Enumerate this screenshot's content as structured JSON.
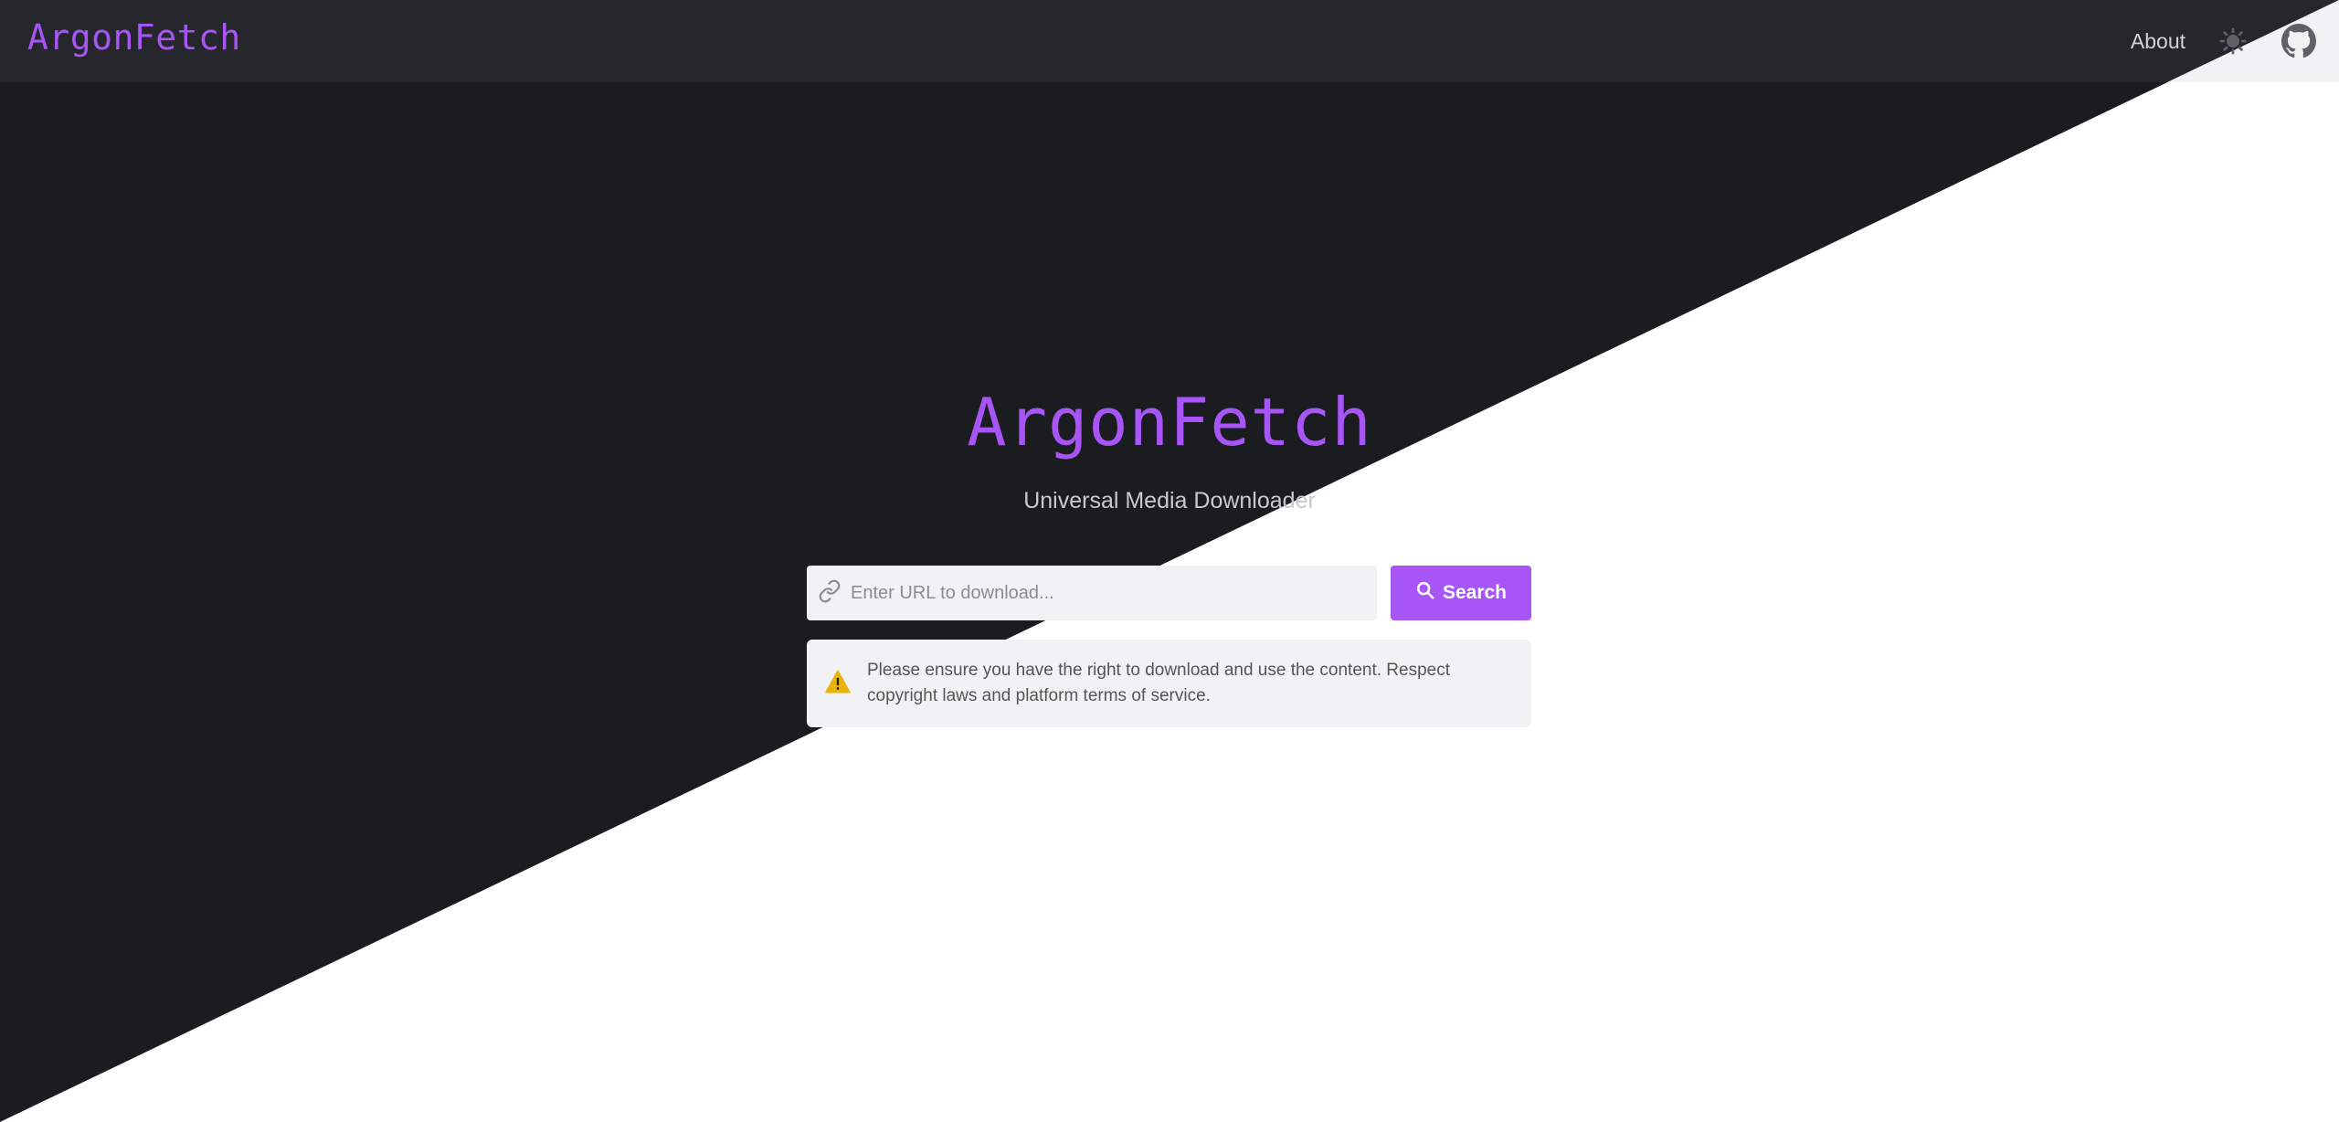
{
  "navbar": {
    "brand": "ArgonFetch",
    "about_label": "About",
    "theme_icon": "sun-icon",
    "github_icon": "github-icon"
  },
  "hero": {
    "title": "ArgonFetch",
    "subtitle": "Universal Media Downloader"
  },
  "search": {
    "link_icon": "link-icon",
    "placeholder": "Enter URL to download...",
    "value": "",
    "button_label": "Search",
    "button_icon": "search-icon"
  },
  "notice": {
    "icon": "warning-icon",
    "text": "Please ensure you have the right to download and use the content. Respect copyright laws and platform terms of service."
  },
  "colors": {
    "accent": "#a855f7",
    "dark_bg": "#1b1c20",
    "navbar_bg": "#26272c",
    "warning": "#eab308"
  }
}
